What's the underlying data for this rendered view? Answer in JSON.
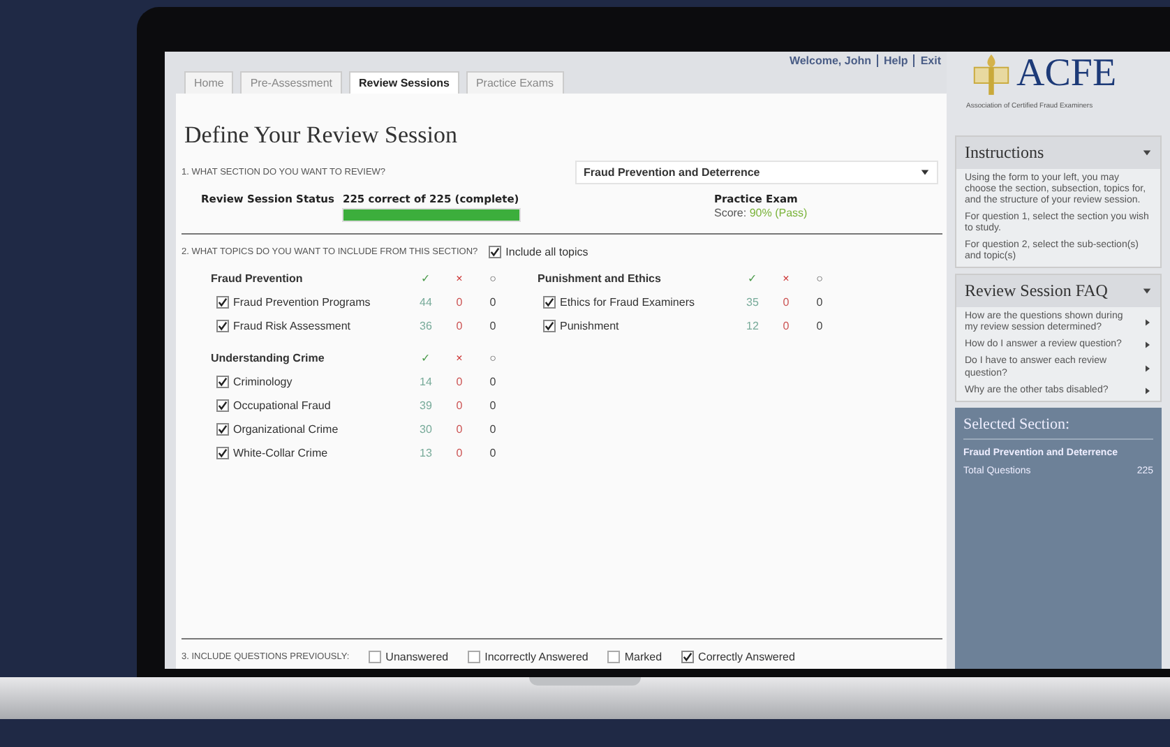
{
  "tabs": [
    {
      "label": "Home",
      "selected": false
    },
    {
      "label": "Pre-Assessment",
      "selected": false
    },
    {
      "label": "Review Sessions",
      "selected": true
    },
    {
      "label": "Practice Exams",
      "selected": false
    }
  ],
  "user_links": [
    "Welcome, John",
    "Help",
    "Exit"
  ],
  "title": "Define Your Review Session",
  "question_1": {
    "label": "1. WHAT SECTION DO YOU WANT TO REVIEW?",
    "value": "Fraud Prevention and Deterrence"
  },
  "status": {
    "label": "Review Session Status",
    "text": "225 correct of 225 (complete)",
    "level": 1
  },
  "practice_exam": {
    "title": "Practice Exam",
    "score_label": "Score:",
    "score": "90% (Pass)"
  },
  "question_2": {
    "label": "2. WHAT TOPICS DO YOU WANT TO INCLUDE FROM THIS SECTION?",
    "include_all": {
      "label": "Include all topics",
      "checked": true
    }
  },
  "groups": [
    {
      "name": "Fraud Prevention",
      "marks": [
        "✓",
        "×",
        "○"
      ],
      "topics": [
        {
          "name": "Fraud Prevention Programs",
          "checked": true,
          "correct": "44",
          "wrong": "0",
          "open": "0"
        },
        {
          "name": "Fraud Risk Assessment",
          "checked": true,
          "correct": "36",
          "wrong": "0",
          "open": "0"
        }
      ]
    },
    {
      "name": "Punishment and Ethics",
      "marks": [
        "✓",
        "×",
        "○"
      ],
      "topics": [
        {
          "name": "Ethics for Fraud Examiners",
          "checked": true,
          "correct": "35",
          "wrong": "0",
          "open": "0"
        },
        {
          "name": "Punishment",
          "checked": true,
          "correct": "12",
          "wrong": "0",
          "open": "0"
        }
      ]
    },
    {
      "name": "Understanding Crime",
      "marks": [
        "✓",
        "×",
        "○"
      ],
      "topics": [
        {
          "name": "Criminology",
          "checked": true,
          "correct": "14",
          "wrong": "0",
          "open": "0"
        },
        {
          "name": "Occupational Fraud",
          "checked": true,
          "correct": "39",
          "wrong": "0",
          "open": "0"
        },
        {
          "name": "Organizational Crime",
          "checked": true,
          "correct": "30",
          "wrong": "0",
          "open": "0"
        },
        {
          "name": "White-Collar Crime",
          "checked": true,
          "correct": "13",
          "wrong": "0",
          "open": "0"
        }
      ]
    }
  ],
  "question_3": {
    "label": "3. INCLUDE QUESTIONS PREVIOUSLY:",
    "options": [
      {
        "label": "Unanswered",
        "checked": false
      },
      {
        "label": "Incorrectly Answered",
        "checked": false
      },
      {
        "label": "Marked",
        "checked": false
      },
      {
        "label": "Correctly Answered",
        "checked": true
      }
    ]
  },
  "sidebar": {
    "logo": "ACFE",
    "subtitle": "Association of Certified Fraud Examiners",
    "instructions": {
      "title": "Instructions",
      "paragraphs": [
        "Using the form to your left, you may choose the section, subsection, topics for, and the structure of your review session.",
        "For question 1, select the section you wish to study.",
        "For question 2, select the sub-section(s) and topic(s)"
      ]
    },
    "faq": {
      "title": "Review Session FAQ",
      "items": [
        "How are the questions shown during my review session determined?",
        "How do I answer a review question?",
        "Do I have to answer each review question?",
        "Why are the other tabs disabled?"
      ]
    },
    "selected_section": {
      "title": "Selected Section:",
      "name": "Fraud Prevention and Deterrence",
      "total_label": "Total Questions",
      "total": "225"
    }
  }
}
